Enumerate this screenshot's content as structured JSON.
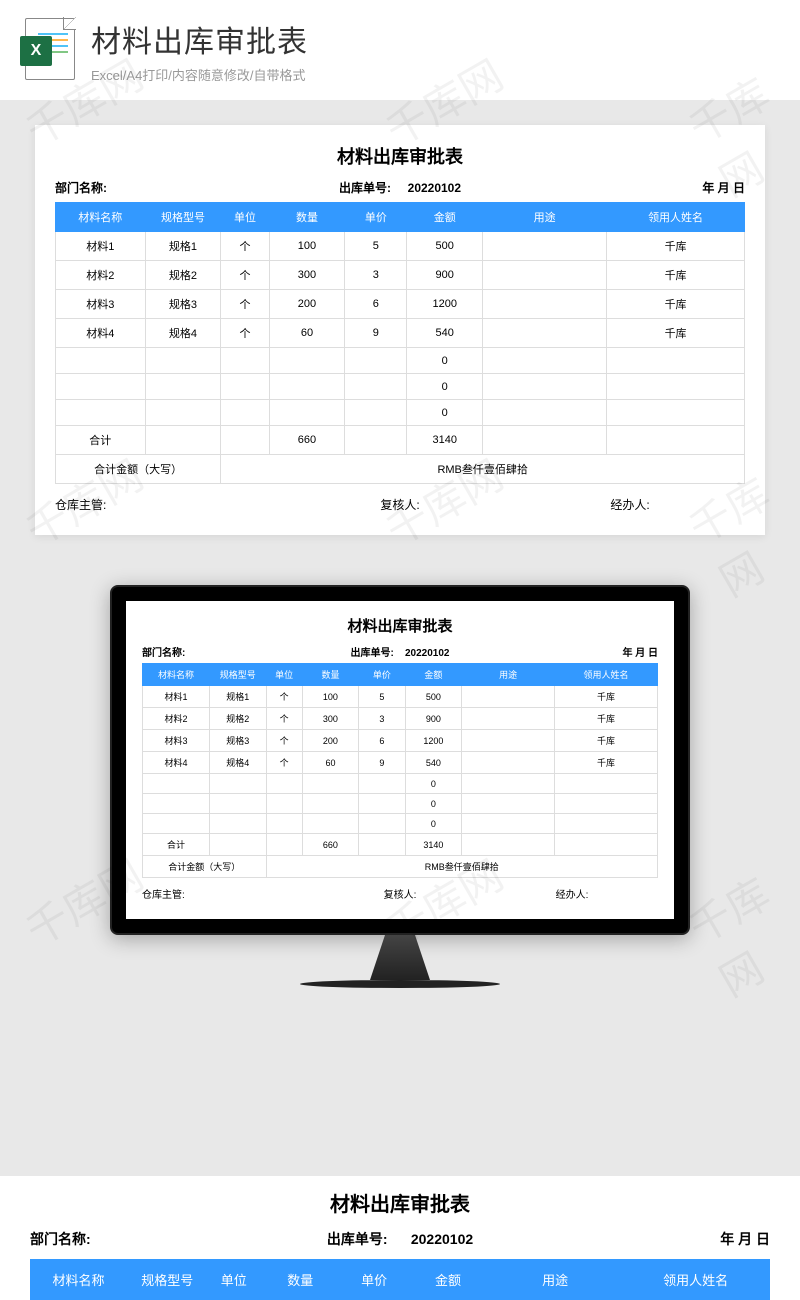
{
  "header": {
    "title": "材料出库审批表",
    "subtitle": "Excel/A4打印/内容随意修改/自带格式",
    "icon_label": "X"
  },
  "form": {
    "title": "材料出库审批表",
    "dept_label": "部门名称:",
    "order_label": "出库单号:",
    "order_value": "20220102",
    "date_label": "年  月  日",
    "columns": [
      "材料名称",
      "规格型号",
      "单位",
      "数量",
      "单价",
      "金额",
      "用途",
      "领用人姓名"
    ],
    "rows": [
      {
        "name": "材料1",
        "spec": "规格1",
        "unit": "个",
        "qty": "100",
        "price": "5",
        "amount": "500",
        "use": "",
        "person": "千库"
      },
      {
        "name": "材料2",
        "spec": "规格2",
        "unit": "个",
        "qty": "300",
        "price": "3",
        "amount": "900",
        "use": "",
        "person": "千库"
      },
      {
        "name": "材料3",
        "spec": "规格3",
        "unit": "个",
        "qty": "200",
        "price": "6",
        "amount": "1200",
        "use": "",
        "person": "千库"
      },
      {
        "name": "材料4",
        "spec": "规格4",
        "unit": "个",
        "qty": "60",
        "price": "9",
        "amount": "540",
        "use": "",
        "person": "千库"
      },
      {
        "name": "",
        "spec": "",
        "unit": "",
        "qty": "",
        "price": "",
        "amount": "0",
        "use": "",
        "person": ""
      },
      {
        "name": "",
        "spec": "",
        "unit": "",
        "qty": "",
        "price": "",
        "amount": "0",
        "use": "",
        "person": ""
      },
      {
        "name": "",
        "spec": "",
        "unit": "",
        "qty": "",
        "price": "",
        "amount": "0",
        "use": "",
        "person": ""
      }
    ],
    "total_label": "合计",
    "total_qty": "660",
    "total_amount": "3140",
    "caps_label": "合计金额（大写）",
    "caps_value": "RMB叁仟壹佰肆拾",
    "footer": {
      "warehouse": "仓库主管:",
      "reviewer": "复核人:",
      "handler": "经办人:"
    }
  },
  "watermark_text": "千库网",
  "colors": {
    "header_blue": "#3399ff",
    "excel_green": "#1d7044"
  }
}
